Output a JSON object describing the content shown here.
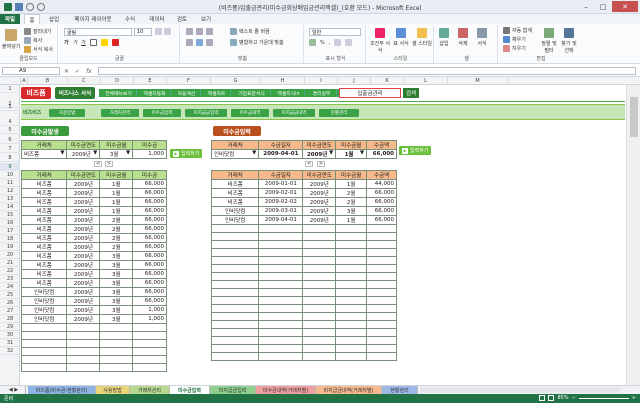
{
  "window": {
    "title": "(비즈폼)입출금관리(미수금회상매입금관리엑셀)_(호환 모드) - Microsoft Excel",
    "min": "–",
    "max": "□",
    "close": "✕"
  },
  "ribbon_tabs": [
    "파일",
    "홈",
    "삽입",
    "페이지 레이아웃",
    "수식",
    "데이터",
    "검토",
    "보기"
  ],
  "ribbon": {
    "clipboard": {
      "name": "클립보드",
      "paste": "붙여넣기",
      "cut": "잘라내기",
      "copy": "복사",
      "format_painter": "서식 복사"
    },
    "font": {
      "name": "글꼴",
      "font_name": "굴림",
      "font_size": "10",
      "bold": "가",
      "italic": "가",
      "underline": "가"
    },
    "align": {
      "name": "맞춤",
      "wrap": "텍스트 줄 바꿈",
      "merge": "병합하고 가운데 맞춤"
    },
    "number": {
      "name": "표시 형식",
      "format": "일반",
      "percent": "%",
      "comma": ","
    },
    "styles": {
      "name": "스타일",
      "cond": "조건부 서식",
      "table": "표 서식",
      "cell": "셀 스타일"
    },
    "cells": {
      "name": "셀",
      "insert": "삽입",
      "delete": "삭제",
      "format": "서식"
    },
    "edit": {
      "name": "편집",
      "autosum": "자동 합계",
      "fill": "채우기",
      "clear": "지우기",
      "sort": "정렬 및 필터",
      "find": "찾기 및 선택"
    }
  },
  "formula_bar": {
    "name_box": "A9",
    "fx": "fx",
    "value": ""
  },
  "columns": [
    "A",
    "B",
    "C",
    "D",
    "E",
    "F",
    "G",
    "H",
    "I",
    "J",
    "K",
    "L",
    "M"
  ],
  "rows": [
    "1",
    "2",
    "3",
    "4",
    "5",
    "6",
    "7",
    "8",
    "9",
    "10",
    "11",
    "12",
    "13",
    "14",
    "15",
    "16",
    "17",
    "18",
    "19",
    "20",
    "21",
    "22",
    "23",
    "24",
    "25",
    "26",
    "27",
    "28",
    "29",
    "30",
    "31",
    "32"
  ],
  "logo": {
    "brand": "비즈폼",
    "brand2": "비즈니스 서식"
  },
  "top_nav": [
    "전체메뉴보기",
    "엑셀자동화",
    "자동계산",
    "엑셀차트",
    "기업표준서식",
    "엑셀지식in",
    "경리실무"
  ],
  "search": {
    "value": "입출금관리",
    "button": "검색"
  },
  "sub_nav": {
    "brand": "비즈비즈",
    "items": [
      "사용방법",
      "거래처관리",
      "미수금입력",
      "미지급금입력",
      "미수금내역",
      "미지급금내역",
      "현황관리"
    ]
  },
  "left_section": {
    "label": "미수금발생",
    "input_headers": [
      "거래처",
      "미수금연도",
      "미수금월",
      "미수금"
    ],
    "input_row": {
      "client": "비즈폼",
      "year": "2009년",
      "month": "3월",
      "amount": "1,000"
    },
    "input_button": "입력하기",
    "list_headers": [
      "거래처",
      "미수금연도",
      "미수금월",
      "미수금"
    ],
    "rows": [
      [
        "비즈폼",
        "2009년",
        "1월",
        "66,000"
      ],
      [
        "비즈폼",
        "2009년",
        "1월",
        "66,000"
      ],
      [
        "비즈폼",
        "2009년",
        "1월",
        "66,000"
      ],
      [
        "비즈폼",
        "2009년",
        "1월",
        "66,000"
      ],
      [
        "비즈폼",
        "2009년",
        "2월",
        "66,000"
      ],
      [
        "비즈폼",
        "2009년",
        "2월",
        "66,000"
      ],
      [
        "비즈폼",
        "2009년",
        "2월",
        "66,000"
      ],
      [
        "비즈폼",
        "2009년",
        "2월",
        "66,000"
      ],
      [
        "비즈폼",
        "2009년",
        "3월",
        "66,000"
      ],
      [
        "비즈폼",
        "2009년",
        "3월",
        "66,000"
      ],
      [
        "비즈폼",
        "2009년",
        "3월",
        "66,000"
      ],
      [
        "비즈폼",
        "2009년",
        "3월",
        "66,000"
      ],
      [
        "인비닷컴",
        "2009년",
        "3월",
        "66,000"
      ],
      [
        "인비닷컴",
        "2009년",
        "3월",
        "66,000"
      ],
      [
        "인비닷컴",
        "2009년",
        "3월",
        "1,000"
      ],
      [
        "인비닷컴",
        "2009년",
        "3월",
        "1,000"
      ]
    ]
  },
  "right_section": {
    "label": "미수금입력",
    "input_headers": [
      "거래처",
      "수금일자",
      "미수금연도",
      "미수금월",
      "수금액"
    ],
    "input_row": {
      "client": "인비닷컴",
      "date": "2009-04-01",
      "year": "2009년",
      "month": "1월",
      "amount": "66,000"
    },
    "input_button": "입력하기",
    "list_headers": [
      "거래처",
      "수금일자",
      "미수금연도",
      "미수금월",
      "수금액"
    ],
    "rows": [
      [
        "비즈폼",
        "2009-01-01",
        "2009년",
        "1월",
        "44,000"
      ],
      [
        "비즈폼",
        "2009-02-01",
        "2009년",
        "2월",
        "66,000"
      ],
      [
        "비즈폼",
        "2009-02-02",
        "2009년",
        "2월",
        "66,000"
      ],
      [
        "인비닷컴",
        "2009-03-01",
        "2009년",
        "3월",
        "66,000"
      ],
      [
        "인비닷컴",
        "2009-04-01",
        "2009년",
        "1월",
        "66,000"
      ]
    ]
  },
  "sheet_tabs": [
    "비즈폼(미수금-현황관리)",
    "사용방법",
    "거래처관리",
    "미수금입력",
    "미지급금입력",
    "미수금내역(거래처별)",
    "미지급금내역(거래처별)",
    "현황관리"
  ],
  "active_sheet": "미수금입력",
  "status": {
    "ready": "준비",
    "zoom": "85%"
  }
}
